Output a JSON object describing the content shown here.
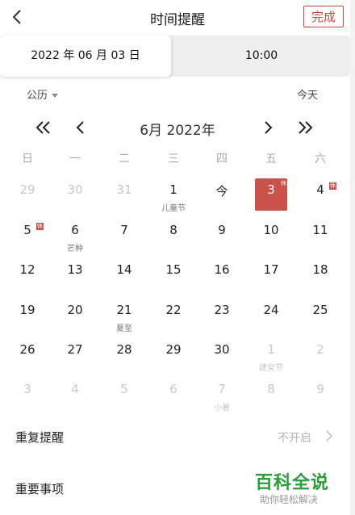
{
  "header": {
    "title": "时间提醒",
    "done_label": "完成"
  },
  "tabs": {
    "date": "2022 年 06 月 03 日",
    "time": "10:00"
  },
  "calendar_type": "公历",
  "today_label": "今天",
  "month_label": "6月 2022年",
  "weekdays": [
    "日",
    "一",
    "二",
    "三",
    "四",
    "五",
    "六"
  ],
  "days": [
    {
      "n": "29",
      "dim": true
    },
    {
      "n": "30",
      "dim": true
    },
    {
      "n": "31",
      "dim": true
    },
    {
      "n": "1",
      "sub": "儿童节"
    },
    {
      "n": "今"
    },
    {
      "n": "3",
      "selected": true,
      "tag": "休"
    },
    {
      "n": "4",
      "tag": "休"
    },
    {
      "n": "5",
      "tag": "休"
    },
    {
      "n": "6",
      "sub": "芒种"
    },
    {
      "n": "7"
    },
    {
      "n": "8"
    },
    {
      "n": "9"
    },
    {
      "n": "10"
    },
    {
      "n": "11"
    },
    {
      "n": "12"
    },
    {
      "n": "13"
    },
    {
      "n": "14"
    },
    {
      "n": "15"
    },
    {
      "n": "16"
    },
    {
      "n": "17"
    },
    {
      "n": "18"
    },
    {
      "n": "19"
    },
    {
      "n": "20"
    },
    {
      "n": "21",
      "sub": "夏至"
    },
    {
      "n": "22"
    },
    {
      "n": "23"
    },
    {
      "n": "24"
    },
    {
      "n": "25"
    },
    {
      "n": "26"
    },
    {
      "n": "27"
    },
    {
      "n": "28"
    },
    {
      "n": "29"
    },
    {
      "n": "30"
    },
    {
      "n": "1",
      "sub": "建党节",
      "dim": true
    },
    {
      "n": "2",
      "dim": true
    },
    {
      "n": "3",
      "dim": true
    },
    {
      "n": "4",
      "dim": true
    },
    {
      "n": "5",
      "dim": true
    },
    {
      "n": "6",
      "dim": true
    },
    {
      "n": "7",
      "sub": "小暑",
      "dim": true
    },
    {
      "n": "8",
      "dim": true
    },
    {
      "n": "9",
      "dim": true
    }
  ],
  "repeat": {
    "label": "重复提醒",
    "value": "不开启"
  },
  "important": {
    "label": "重要事项"
  },
  "watermark": {
    "title": "百科全说",
    "subtitle": "助你轻松解决"
  },
  "icons": {
    "back": "chevron-left-icon",
    "next": "chevron-right-icon"
  },
  "colors": {
    "accent": "#c9463d",
    "selected_day": "#c9534a"
  }
}
